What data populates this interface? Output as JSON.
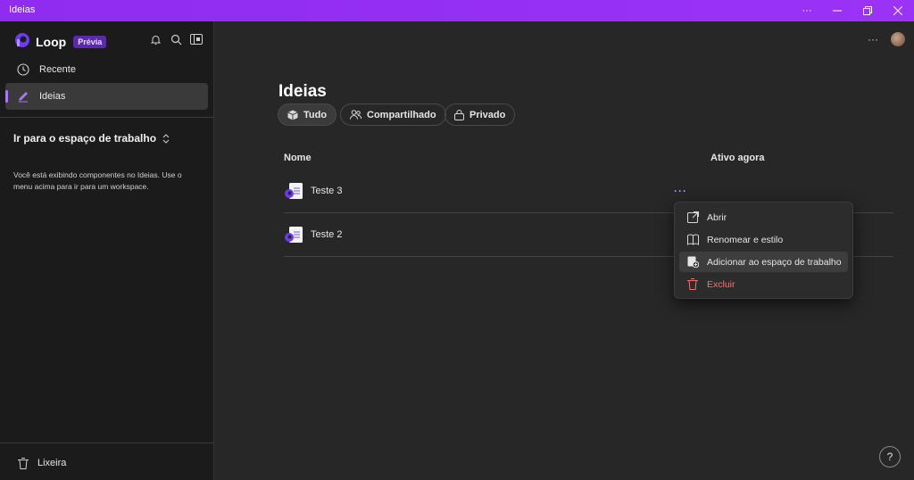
{
  "window": {
    "title": "Ideias",
    "controls": [
      "more-icon",
      "minimize-icon",
      "restore-icon",
      "close-icon"
    ],
    "more_glyph": "···"
  },
  "sidebar": {
    "app_name": "Loop",
    "badge": "Prévia",
    "icons": [
      "bell-icon",
      "search-icon",
      "panel-icon"
    ],
    "items": [
      {
        "label": "Recente",
        "icon": "clock-icon"
      },
      {
        "label": "Ideias",
        "icon": "pen-icon",
        "active": true
      }
    ],
    "workspace_heading": "Ir para o espaço de trabalho",
    "workspace_desc": "Você está exibindo componentes no Ideias. Use o menu acima para ir para um workspace.",
    "trash_label": "Lixeira"
  },
  "main": {
    "title": "Ideias",
    "tabs": [
      {
        "label": "Tudo",
        "icon": "cube-icon",
        "selected": true
      },
      {
        "label": "Compartilhado",
        "icon": "people-icon"
      },
      {
        "label": "Privado",
        "icon": "lock-icon"
      }
    ],
    "columns": {
      "name": "Nome",
      "active": "Ativo agora"
    },
    "rows": [
      {
        "name": "Teste 3"
      },
      {
        "name": "Teste 2"
      }
    ],
    "more_glyph": "···",
    "context_menu": [
      {
        "label": "Abrir",
        "icon": "open-external-icon"
      },
      {
        "label": "Renomear e estilo",
        "icon": "rename-icon"
      },
      {
        "label": "Adicionar ao espaço de trabalho",
        "icon": "add-to-workspace-icon",
        "highlighted": true
      },
      {
        "label": "Excluir",
        "icon": "trash-icon",
        "danger": true
      }
    ],
    "help_glyph": "?"
  },
  "colors": {
    "accent": "#9a33f5",
    "background": "#272727",
    "sidebar": "#1b1b1b",
    "danger": "#f07373"
  }
}
